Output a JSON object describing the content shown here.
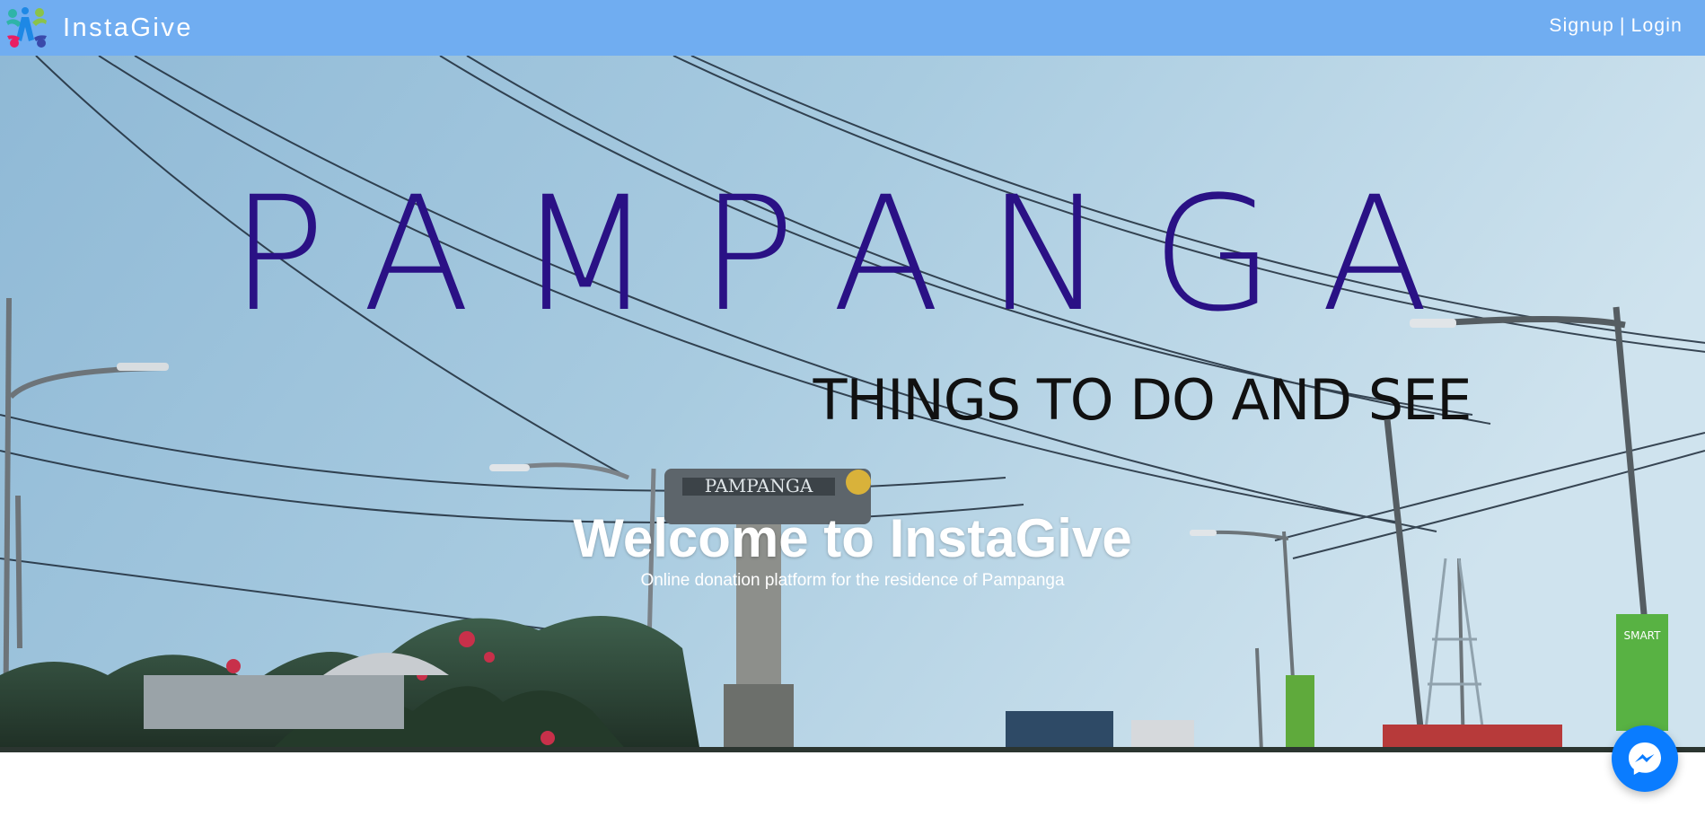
{
  "navbar": {
    "brand_name": "InstaGive",
    "signup_label": "Signup",
    "separator": "|",
    "login_label": "Login"
  },
  "hero": {
    "image_sign_title": "PAMPANGA",
    "image_sign_tagline": "THINGS TO DO AND SEE",
    "heading": "Welcome to InstaGive",
    "subheading": "Online donation platform for the residence of Pampanga"
  },
  "chat_widget": {
    "icon": "messenger-icon"
  },
  "colors": {
    "navbar_bg": "#70adf1",
    "sign_title": "#2a1185",
    "messenger_bg": "#0a7cff"
  }
}
